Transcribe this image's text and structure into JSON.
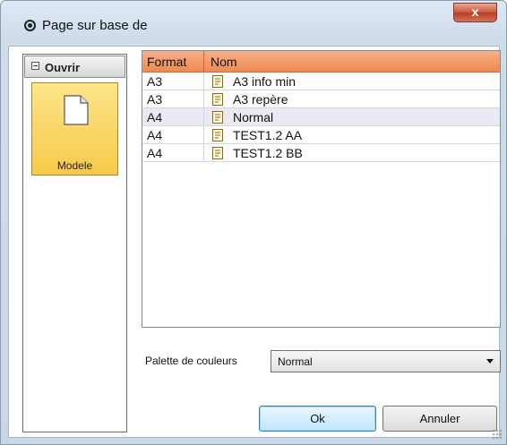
{
  "window": {
    "title": "Page sur base de",
    "close_label": "x"
  },
  "sidebar": {
    "section_label": "Ouvrir",
    "items": [
      {
        "label": "Modele",
        "selected": true
      }
    ]
  },
  "list": {
    "columns": [
      "Format",
      "Nom"
    ],
    "rows": [
      {
        "format": "A3",
        "name": "A3 info min"
      },
      {
        "format": "A3",
        "name": "A3 repère"
      },
      {
        "format": "A4",
        "name": "Normal"
      },
      {
        "format": "A4",
        "name": "TEST1.2 AA"
      },
      {
        "format": "A4",
        "name": "TEST1.2 BB"
      }
    ],
    "selected_index": 2
  },
  "palette": {
    "label": "Palette de couleurs",
    "value": "Normal"
  },
  "buttons": {
    "ok": "Ok",
    "cancel": "Annuler"
  },
  "colors": {
    "header_accent": "#ef8a4f",
    "tile_accent": "#f7c94a"
  }
}
